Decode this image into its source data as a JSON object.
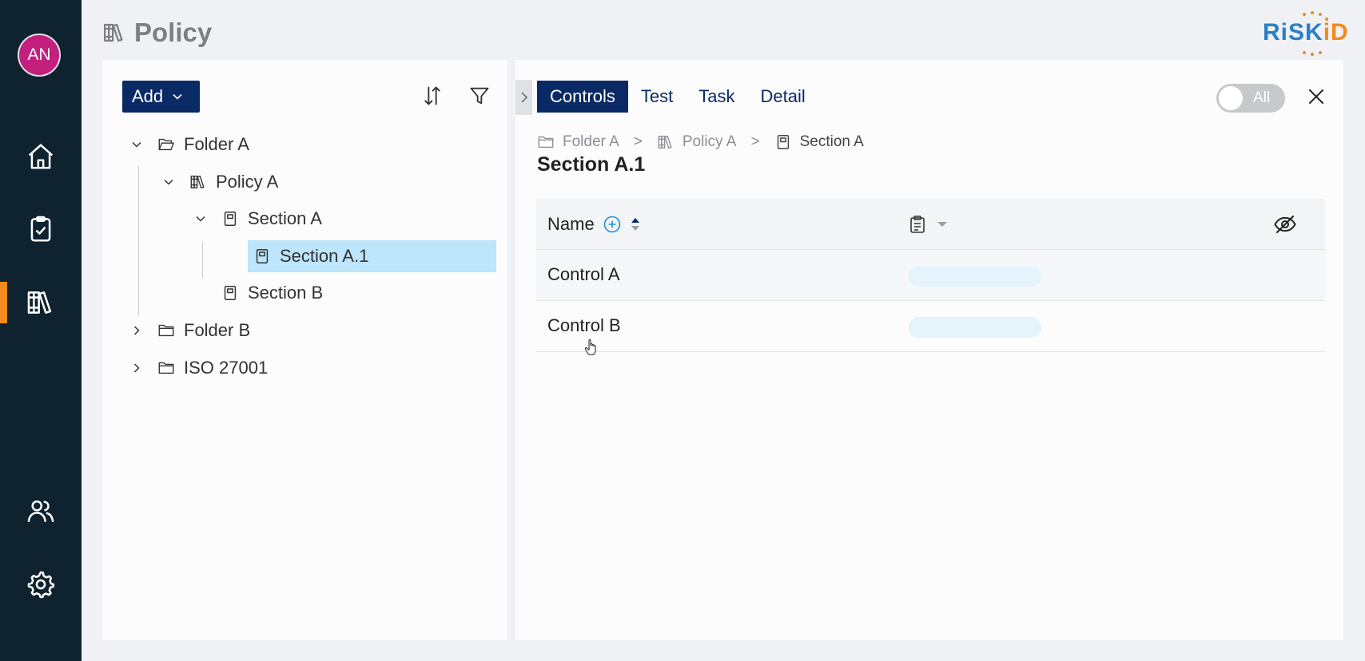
{
  "user": {
    "initials": "AN"
  },
  "nav": {
    "items": [
      {
        "name": "home",
        "icon": "home-icon",
        "active": false
      },
      {
        "name": "tasks",
        "icon": "clipboard-check-icon",
        "active": false
      },
      {
        "name": "policy",
        "icon": "library-icon",
        "active": true
      },
      {
        "name": "users",
        "icon": "users-icon",
        "active": false
      },
      {
        "name": "settings",
        "icon": "gear-icon",
        "active": false
      }
    ]
  },
  "header": {
    "title": "Policy",
    "title_icon": "library-icon"
  },
  "logo": {
    "text_blue": "RiSK",
    "text_orange": "iD"
  },
  "left_panel": {
    "add_label": "Add",
    "sort_icon": "sort-icon",
    "filter_icon": "filter-icon",
    "tree": [
      {
        "label": "Folder A",
        "type": "folder-open",
        "expanded": true
      },
      {
        "label": "Policy A",
        "type": "policy",
        "expanded": true
      },
      {
        "label": "Section A",
        "type": "section",
        "expanded": true
      },
      {
        "label": "Section A.1",
        "type": "section",
        "selected": true
      },
      {
        "label": "Section B",
        "type": "section"
      },
      {
        "label": "Folder B",
        "type": "folder",
        "expanded": false
      },
      {
        "label": "ISO 27001",
        "type": "folder",
        "expanded": false
      }
    ]
  },
  "right_panel": {
    "tabs": [
      {
        "label": "Controls",
        "active": true
      },
      {
        "label": "Test",
        "active": false
      },
      {
        "label": "Task",
        "active": false
      },
      {
        "label": "Detail",
        "active": false
      }
    ],
    "toggle_label": "All",
    "breadcrumb": [
      {
        "label": "Folder A",
        "icon": "folder-icon"
      },
      {
        "label": "Policy A",
        "icon": "library-icon"
      },
      {
        "label": "Section A",
        "icon": "section-icon"
      }
    ],
    "breadcrumb_separator": ">",
    "section_title": "Section A.1",
    "table": {
      "name_header": "Name",
      "rows": [
        {
          "name": "Control A"
        },
        {
          "name": "Control B"
        }
      ]
    }
  },
  "colors": {
    "rail": "#0e2230",
    "accent": "#f28a1c",
    "primary": "#0a2a66",
    "selected": "#bde5fb",
    "avatar": "#c31f7d"
  }
}
